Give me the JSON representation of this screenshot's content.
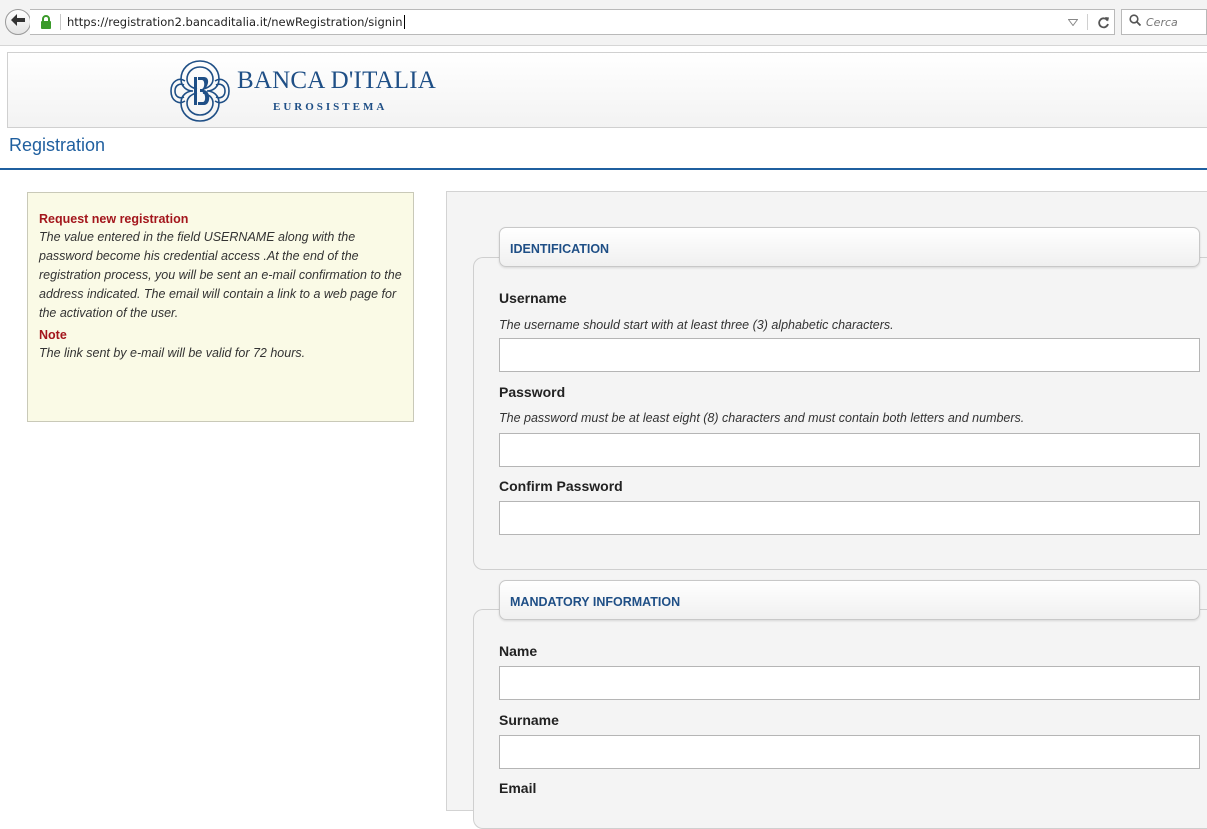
{
  "browser": {
    "url": "https://registration2.bancaditalia.it/newRegistration/signin",
    "search_placeholder": "Cerca",
    "icons": [
      "back-arrow-icon",
      "lock-icon",
      "dropdown-triangle-icon",
      "reload-icon",
      "magnifier-icon"
    ],
    "lock_color": "#3a9a2a"
  },
  "header": {
    "brand_name": "BANCA D'ITALIA",
    "brand_sub": "EUROSISTEMA",
    "brand_color": "#1f4f86"
  },
  "page": {
    "title": "Registration",
    "accent": "#1f5f9f"
  },
  "info": {
    "heading": "Request new registration",
    "text": "The value entered in the field USERNAME along with the password become his credential access .At the end of the registration process, you will be sent an e-mail confirmation to the address indicated. The email will contain a link to a web page for the activation of the user.",
    "note_heading": "Note",
    "note_text": "The link sent by e-mail will be valid for 72 hours.",
    "heading_color": "#a3161c"
  },
  "form": {
    "identification": {
      "legend": "IDENTIFICATION",
      "username_label": "Username",
      "username_hint": "The username should start with at least three (3) alphabetic characters.",
      "username_value": "",
      "password_label": "Password",
      "password_hint": "The password must be at least eight (8) characters and must contain both letters and numbers.",
      "password_value": "",
      "confirm_label": "Confirm Password",
      "confirm_value": ""
    },
    "mandatory": {
      "legend": "MANDATORY INFORMATION",
      "name_label": "Name",
      "name_value": "",
      "surname_label": "Surname",
      "surname_value": "",
      "email_label": "Email"
    }
  }
}
